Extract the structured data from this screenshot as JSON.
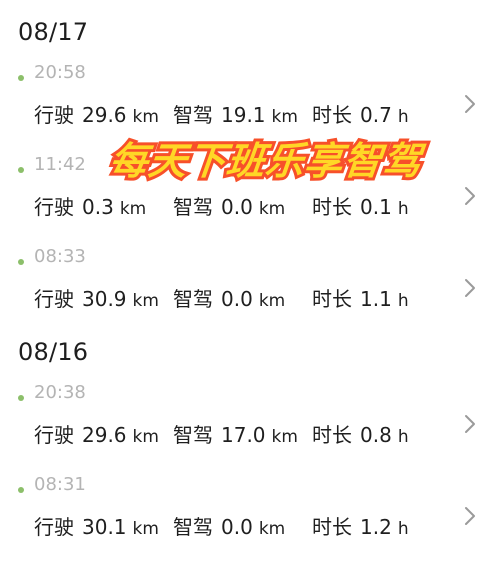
{
  "groups": [
    {
      "date": "08/17",
      "trips": [
        {
          "time": "20:58",
          "drive_label": "行驶",
          "drive_value": "29.6",
          "drive_unit": "km",
          "smart_label": "智驾",
          "smart_value": "19.1",
          "smart_unit": "km",
          "dur_label": "时长",
          "dur_value": "0.7",
          "dur_unit": "h"
        },
        {
          "time": "11:42",
          "drive_label": "行驶",
          "drive_value": "0.3",
          "drive_unit": "km",
          "smart_label": "智驾",
          "smart_value": "0.0",
          "smart_unit": "km",
          "dur_label": "时长",
          "dur_value": "0.1",
          "dur_unit": "h"
        },
        {
          "time": "08:33",
          "drive_label": "行驶",
          "drive_value": "30.9",
          "drive_unit": "km",
          "smart_label": "智驾",
          "smart_value": "0.0",
          "smart_unit": "km",
          "dur_label": "时长",
          "dur_value": "1.1",
          "dur_unit": "h"
        }
      ]
    },
    {
      "date": "08/16",
      "trips": [
        {
          "time": "20:38",
          "drive_label": "行驶",
          "drive_value": "29.6",
          "drive_unit": "km",
          "smart_label": "智驾",
          "smart_value": "17.0",
          "smart_unit": "km",
          "dur_label": "时长",
          "dur_value": "0.8",
          "dur_unit": "h"
        },
        {
          "time": "08:31",
          "drive_label": "行驶",
          "drive_value": "30.1",
          "drive_unit": "km",
          "smart_label": "智驾",
          "smart_value": "0.0",
          "smart_unit": "km",
          "dur_label": "时长",
          "dur_value": "1.2",
          "dur_unit": "h"
        }
      ]
    }
  ],
  "banner_text": "每天下班乐享智驾",
  "colors": {
    "accent_dot": "#8cbf6a",
    "banner_fill": "#ffd726",
    "banner_stroke": "#f7502a",
    "chevron": "#9a9a9a"
  }
}
